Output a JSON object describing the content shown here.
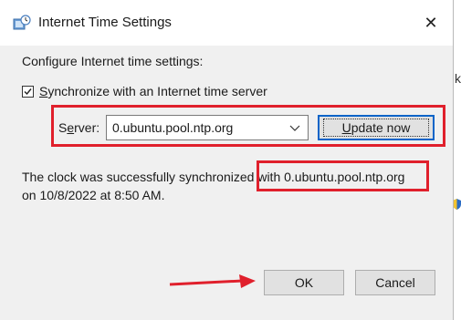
{
  "window": {
    "title": "Internet Time Settings",
    "icon": "clock-globe-icon",
    "close_glyph": "✕"
  },
  "section": {
    "label": "Configure Internet time settings:"
  },
  "sync": {
    "checked": true,
    "label_mnemonic": "S",
    "label_rest": "ynchronize with an Internet time server"
  },
  "server": {
    "label_mnemonic": "e",
    "label_pre": "S",
    "label_post": "rver:",
    "value": "0.ubuntu.pool.ntp.org"
  },
  "update_button": {
    "label_mnemonic": "U",
    "label_rest": "pdate now"
  },
  "status": {
    "line1_pre": "The clock was successfully synchronized ",
    "line1_highlight": "with 0.ubuntu.pool.ntp.org",
    "line2": "on 10/8/2022 at 8:50 AM."
  },
  "buttons": {
    "ok": "OK",
    "cancel": "Cancel"
  },
  "annotation_color": "#e0202c",
  "background_glyph": "k"
}
